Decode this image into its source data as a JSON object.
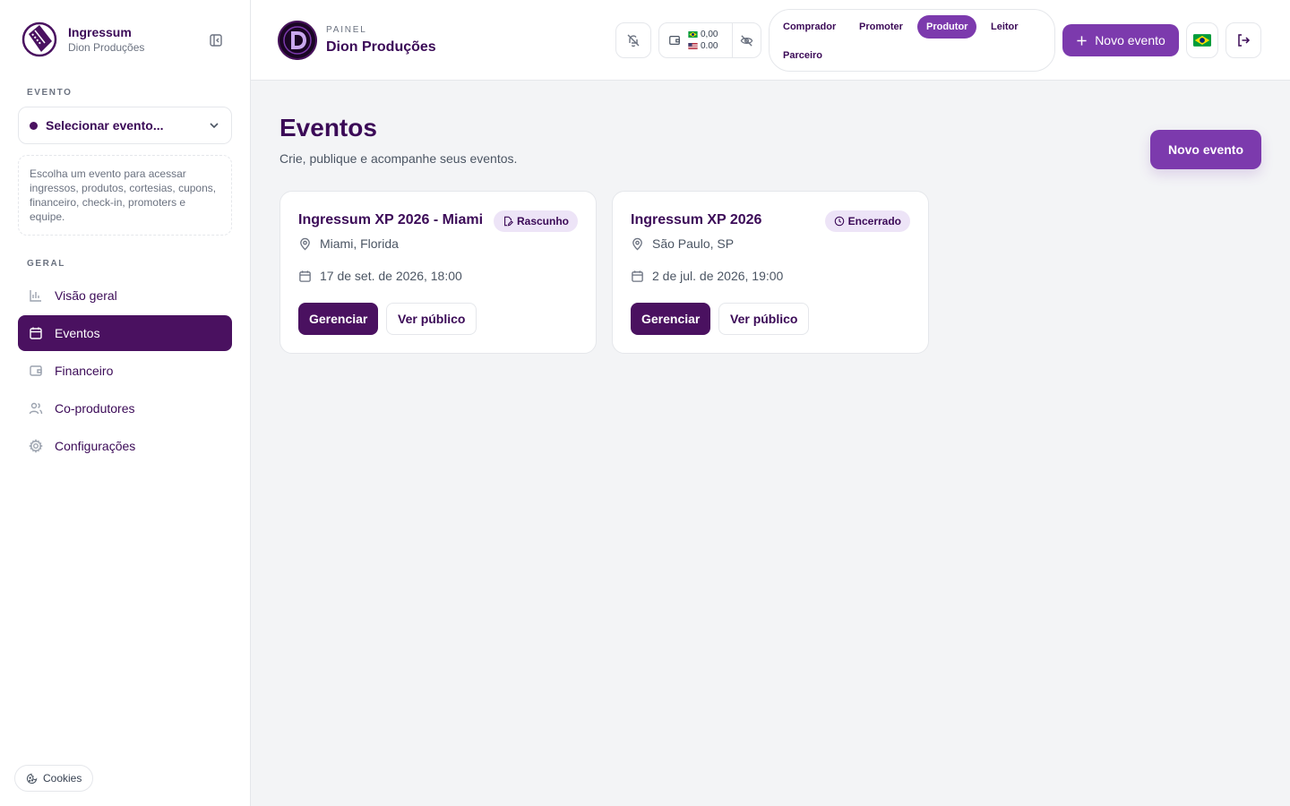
{
  "brand": {
    "name": "Ingressum",
    "org": "Dion Produções"
  },
  "sidebar": {
    "event_section": "EVENTO",
    "event_select_label": "Selecionar evento...",
    "event_hint": "Escolha um evento para acessar ingressos, produtos, cortesias, cupons, financeiro, check-in, promoters e equipe.",
    "general_section": "GERAL",
    "items": [
      {
        "label": "Visão geral",
        "icon": "bar-chart-icon",
        "active": false
      },
      {
        "label": "Eventos",
        "icon": "calendar-icon",
        "active": true
      },
      {
        "label": "Financeiro",
        "icon": "wallet-icon",
        "active": false
      },
      {
        "label": "Co-produtores",
        "icon": "users-icon",
        "active": false
      },
      {
        "label": "Configurações",
        "icon": "gear-icon",
        "active": false
      }
    ],
    "cookies_label": "Cookies"
  },
  "header": {
    "kicker": "PAINEL",
    "title": "Dion Produções",
    "wallet": {
      "brl": "0,00",
      "usd": "0.00"
    },
    "roles": [
      {
        "label": "Comprador",
        "active": false
      },
      {
        "label": "Promoter",
        "active": false
      },
      {
        "label": "Produtor",
        "active": true
      },
      {
        "label": "Leitor",
        "active": false
      },
      {
        "label": "Parceiro",
        "active": false
      }
    ],
    "new_event_label": "Novo evento",
    "language_flag": "brazil-flag-icon"
  },
  "main": {
    "title": "Eventos",
    "subtitle": "Crie, publique e acompanhe seus eventos.",
    "new_event_label": "Novo evento",
    "events": [
      {
        "title": "Ingressum XP 2026 - Miami",
        "status": "Rascunho",
        "status_icon": "draft-icon",
        "location": "Miami, Florida",
        "datetime": "17 de set. de 2026, 18:00",
        "manage_label": "Gerenciar",
        "public_label": "Ver público"
      },
      {
        "title": "Ingressum XP 2026",
        "status": "Encerrado",
        "status_icon": "clock-icon",
        "location": "São Paulo, SP",
        "datetime": "2 de jul. de 2026, 19:00",
        "manage_label": "Gerenciar",
        "public_label": "Ver público"
      }
    ]
  },
  "colors": {
    "primary": "#7c3aad",
    "primary_dark": "#4a1160",
    "text_brand": "#3b0a57",
    "badge_bg": "#ede4f7"
  }
}
